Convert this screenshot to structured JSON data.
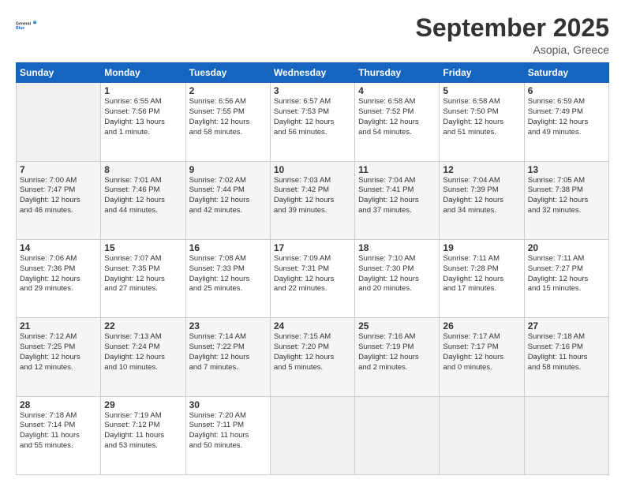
{
  "logo": {
    "line1": "General",
    "line2": "Blue"
  },
  "title": "September 2025",
  "subtitle": "Asopia, Greece",
  "days_header": [
    "Sunday",
    "Monday",
    "Tuesday",
    "Wednesday",
    "Thursday",
    "Friday",
    "Saturday"
  ],
  "weeks": [
    [
      {
        "day": "",
        "info": ""
      },
      {
        "day": "1",
        "info": "Sunrise: 6:55 AM\nSunset: 7:56 PM\nDaylight: 13 hours\nand 1 minute."
      },
      {
        "day": "2",
        "info": "Sunrise: 6:56 AM\nSunset: 7:55 PM\nDaylight: 12 hours\nand 58 minutes."
      },
      {
        "day": "3",
        "info": "Sunrise: 6:57 AM\nSunset: 7:53 PM\nDaylight: 12 hours\nand 56 minutes."
      },
      {
        "day": "4",
        "info": "Sunrise: 6:58 AM\nSunset: 7:52 PM\nDaylight: 12 hours\nand 54 minutes."
      },
      {
        "day": "5",
        "info": "Sunrise: 6:58 AM\nSunset: 7:50 PM\nDaylight: 12 hours\nand 51 minutes."
      },
      {
        "day": "6",
        "info": "Sunrise: 6:59 AM\nSunset: 7:49 PM\nDaylight: 12 hours\nand 49 minutes."
      }
    ],
    [
      {
        "day": "7",
        "info": "Sunrise: 7:00 AM\nSunset: 7:47 PM\nDaylight: 12 hours\nand 46 minutes."
      },
      {
        "day": "8",
        "info": "Sunrise: 7:01 AM\nSunset: 7:46 PM\nDaylight: 12 hours\nand 44 minutes."
      },
      {
        "day": "9",
        "info": "Sunrise: 7:02 AM\nSunset: 7:44 PM\nDaylight: 12 hours\nand 42 minutes."
      },
      {
        "day": "10",
        "info": "Sunrise: 7:03 AM\nSunset: 7:42 PM\nDaylight: 12 hours\nand 39 minutes."
      },
      {
        "day": "11",
        "info": "Sunrise: 7:04 AM\nSunset: 7:41 PM\nDaylight: 12 hours\nand 37 minutes."
      },
      {
        "day": "12",
        "info": "Sunrise: 7:04 AM\nSunset: 7:39 PM\nDaylight: 12 hours\nand 34 minutes."
      },
      {
        "day": "13",
        "info": "Sunrise: 7:05 AM\nSunset: 7:38 PM\nDaylight: 12 hours\nand 32 minutes."
      }
    ],
    [
      {
        "day": "14",
        "info": "Sunrise: 7:06 AM\nSunset: 7:36 PM\nDaylight: 12 hours\nand 29 minutes."
      },
      {
        "day": "15",
        "info": "Sunrise: 7:07 AM\nSunset: 7:35 PM\nDaylight: 12 hours\nand 27 minutes."
      },
      {
        "day": "16",
        "info": "Sunrise: 7:08 AM\nSunset: 7:33 PM\nDaylight: 12 hours\nand 25 minutes."
      },
      {
        "day": "17",
        "info": "Sunrise: 7:09 AM\nSunset: 7:31 PM\nDaylight: 12 hours\nand 22 minutes."
      },
      {
        "day": "18",
        "info": "Sunrise: 7:10 AM\nSunset: 7:30 PM\nDaylight: 12 hours\nand 20 minutes."
      },
      {
        "day": "19",
        "info": "Sunrise: 7:11 AM\nSunset: 7:28 PM\nDaylight: 12 hours\nand 17 minutes."
      },
      {
        "day": "20",
        "info": "Sunrise: 7:11 AM\nSunset: 7:27 PM\nDaylight: 12 hours\nand 15 minutes."
      }
    ],
    [
      {
        "day": "21",
        "info": "Sunrise: 7:12 AM\nSunset: 7:25 PM\nDaylight: 12 hours\nand 12 minutes."
      },
      {
        "day": "22",
        "info": "Sunrise: 7:13 AM\nSunset: 7:24 PM\nDaylight: 12 hours\nand 10 minutes."
      },
      {
        "day": "23",
        "info": "Sunrise: 7:14 AM\nSunset: 7:22 PM\nDaylight: 12 hours\nand 7 minutes."
      },
      {
        "day": "24",
        "info": "Sunrise: 7:15 AM\nSunset: 7:20 PM\nDaylight: 12 hours\nand 5 minutes."
      },
      {
        "day": "25",
        "info": "Sunrise: 7:16 AM\nSunset: 7:19 PM\nDaylight: 12 hours\nand 2 minutes."
      },
      {
        "day": "26",
        "info": "Sunrise: 7:17 AM\nSunset: 7:17 PM\nDaylight: 12 hours\nand 0 minutes."
      },
      {
        "day": "27",
        "info": "Sunrise: 7:18 AM\nSunset: 7:16 PM\nDaylight: 11 hours\nand 58 minutes."
      }
    ],
    [
      {
        "day": "28",
        "info": "Sunrise: 7:18 AM\nSunset: 7:14 PM\nDaylight: 11 hours\nand 55 minutes."
      },
      {
        "day": "29",
        "info": "Sunrise: 7:19 AM\nSunset: 7:12 PM\nDaylight: 11 hours\nand 53 minutes."
      },
      {
        "day": "30",
        "info": "Sunrise: 7:20 AM\nSunset: 7:11 PM\nDaylight: 11 hours\nand 50 minutes."
      },
      {
        "day": "",
        "info": ""
      },
      {
        "day": "",
        "info": ""
      },
      {
        "day": "",
        "info": ""
      },
      {
        "day": "",
        "info": ""
      }
    ]
  ]
}
